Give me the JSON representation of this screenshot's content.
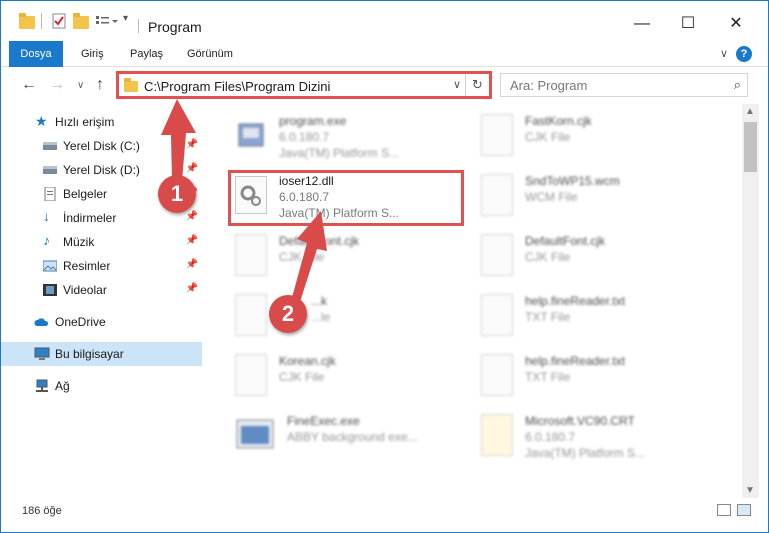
{
  "window": {
    "title": "Program",
    "minimize_label": "—",
    "maximize_label": "☐",
    "close_label": "✕"
  },
  "ribbon": {
    "tabs": [
      "Dosya",
      "Giriş",
      "Paylaş",
      "Görünüm"
    ],
    "collapse_icon": "∨",
    "help_icon": "?"
  },
  "nav": {
    "back": "←",
    "forward": "→",
    "recent": "∨",
    "up": "↑",
    "address": "C:\\Program Files\\Program Dizini",
    "address_dropdown": "∨",
    "refresh": "↻",
    "search_placeholder": "Ara: Program",
    "search_icon": "⌕"
  },
  "sidebar": {
    "items": [
      {
        "label": "Hızlı erişim",
        "icon": "star-icon"
      },
      {
        "label": "Yerel Disk (C:)",
        "icon": "drive-icon",
        "pin": "📌"
      },
      {
        "label": "Yerel Disk (D:)",
        "icon": "drive-icon",
        "pin": "📌"
      },
      {
        "label": "Belgeler",
        "icon": "documents-icon",
        "pin": "📌"
      },
      {
        "label": "İndirmeler",
        "icon": "download-icon",
        "pin": "📌"
      },
      {
        "label": "Müzik",
        "icon": "music-icon",
        "pin": "📌"
      },
      {
        "label": "Resimler",
        "icon": "pictures-icon",
        "pin": "📌"
      },
      {
        "label": "Videolar",
        "icon": "videos-icon",
        "pin": "📌"
      },
      {
        "label": "OneDrive",
        "icon": "cloud-icon"
      },
      {
        "label": "Bu bilgisayar",
        "icon": "computer-icon"
      },
      {
        "label": "Ağ",
        "icon": "network-icon"
      }
    ]
  },
  "files": [
    {
      "name": "program.exe",
      "line1": "6.0.180.7",
      "line2": "Java(TM) Platform S..."
    },
    {
      "name": "FastKorn.cjk",
      "line1": "CJK File",
      "line2": ""
    },
    {
      "name": "ioser12.dll",
      "line1": "6.0.180.7",
      "line2": "Java(TM) Platform S..."
    },
    {
      "name": "SndToWP15.wcm",
      "line1": "WCM File",
      "line2": ""
    },
    {
      "name": "DefaultFont.cjk",
      "line1": "CJK File",
      "line2": ""
    },
    {
      "name": "DefaultFont.cjk",
      "line1": "CJK File",
      "line2": ""
    },
    {
      "name": "...k",
      "line1": "...le",
      "line2": ""
    },
    {
      "name": "help.fineReader.txt",
      "line1": "TXT File",
      "line2": ""
    },
    {
      "name": "Korean.cjk",
      "line1": "CJK File",
      "line2": ""
    },
    {
      "name": "help.fineReader.txt",
      "line1": "TXT File",
      "line2": ""
    },
    {
      "name": "FineExec.exe",
      "line1": "ABBY background exe...",
      "line2": ""
    },
    {
      "name": "Microsoft.VC90.CRT",
      "line1": "6.0.180.7",
      "line2": "Java(TM) Platform S..."
    }
  ],
  "status": {
    "count": "186 öğe"
  },
  "callouts": [
    "1",
    "2"
  ],
  "colors": {
    "accent": "#1979ca",
    "highlight": "#e05252",
    "callout": "#d94a4a"
  }
}
